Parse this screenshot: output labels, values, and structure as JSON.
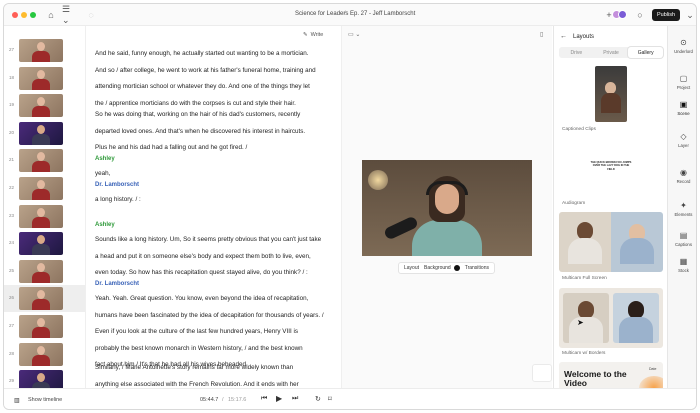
{
  "window": {
    "show_name": "Science for Leaders",
    "separator": "/",
    "episode": "Ep. 27 - Jeff Lamborscht",
    "publish_label": "Publish"
  },
  "thumbnails": {
    "items": [
      {
        "num": "27"
      },
      {
        "num": "18"
      },
      {
        "num": "19"
      },
      {
        "num": "20"
      },
      {
        "num": "21"
      },
      {
        "num": "22"
      },
      {
        "num": "23"
      },
      {
        "num": "24"
      },
      {
        "num": "25"
      },
      {
        "num": "26"
      },
      {
        "num": "27"
      },
      {
        "num": "28"
      },
      {
        "num": "29"
      }
    ],
    "active_num": "26"
  },
  "transcript": {
    "write_label": "Write",
    "paragraphs": [
      {
        "lines": [
          "And he said, funny enough, he actually started out wanting to be a mortician.",
          "And so  /  after college, he went to work at his father's funeral home, training and",
          "attending mortician school or whatever they do. And one of the things they let",
          "the  /  apprentice morticians do with the corpses is cut and style their hair."
        ]
      },
      {
        "lines": [
          "So he was doing that, working on the hair of  his dad's customers, recently",
          "departed loved ones. And that's when he discovered his interest in haircuts.",
          "Plus he and his dad had a falling out and he got fired.  /"
        ]
      },
      {
        "speaker": "Ashley",
        "lines": [
          "yeah,"
        ]
      },
      {
        "speaker": "Dr. Lamborscht",
        "lines": [
          "a long history.  /  :"
        ]
      },
      {
        "speaker": "Ashley",
        "lines": [
          "Sounds like a long history. Um, So it seems pretty obvious that you can't just take",
          "a head and put it on someone else's body and expect them both to live, even,",
          "even today. So how has this recapitation quest stayed alive, do you think?  /  :"
        ]
      },
      {
        "speaker": "Dr. Lamborscht",
        "lines": [
          "Yeah. Yeah. Great question. You know,      even beyond the idea of recapitation,",
          "humans have been fascinated by the idea of decapitation for thousands of years.  /",
          "  Even if you look at the culture of the last few hundred years, Henry VIII is",
          "probably the best known monarch in Western history,  /  and the best known",
          "fact about him  /  It's that he had all his wives beheaded."
        ]
      },
      {
        "lines": [
          "Similarly,  /  Marie Antoinette's story remains far more widely known than",
          "anything else associated with the French Revolution. And it ends with her"
        ]
      }
    ]
  },
  "stage": {
    "toolbar_left": "▭ ⌄",
    "toolbar_right": "▯",
    "video_toolbar": {
      "layout_label": "Layout",
      "background_label": "Background",
      "transitions_label": "Transitions"
    }
  },
  "layouts_panel": {
    "back_icon": "←",
    "title": "Layouts",
    "tabs": [
      {
        "label": "Drive",
        "active": false
      },
      {
        "label": "Private",
        "active": false
      },
      {
        "label": "Gallery",
        "active": true
      }
    ],
    "cards": [
      {
        "label": "Captioned Clips"
      },
      {
        "label": "Audiogram",
        "quote": "THE QUICK BROWN FOX JUMPS OVER THE LAZY DOG IN THE FIELD"
      },
      {
        "label": "Multicam Full Screen"
      },
      {
        "label": "Multicam w/ Borders"
      },
      {
        "label": "",
        "headline": "Welcome to the Video",
        "tag": "Date"
      }
    ]
  },
  "rail": {
    "items": [
      {
        "icon": "⊙",
        "label": "Underlord",
        "active": false
      },
      {
        "icon": "▢",
        "label": "Project",
        "active": false
      },
      {
        "icon": "▣",
        "label": "Scene",
        "active": true
      },
      {
        "icon": "◇",
        "label": "Layer",
        "active": false
      },
      {
        "icon": "◉",
        "label": "Record",
        "active": false
      },
      {
        "icon": "✦",
        "label": "Elements",
        "active": false
      },
      {
        "icon": "▤",
        "label": "Captions",
        "active": false
      },
      {
        "icon": "▦",
        "label": "Stock",
        "active": false
      }
    ]
  },
  "bottom": {
    "timeline_label": "Show timeline",
    "current_time": "05:44.7",
    "time_sep": "/",
    "duration": "15:17.6"
  },
  "colors": {
    "speaker_green": "#2f9a3a",
    "speaker_blue": "#3a63b8",
    "publish_bg": "#1b1b1b"
  }
}
